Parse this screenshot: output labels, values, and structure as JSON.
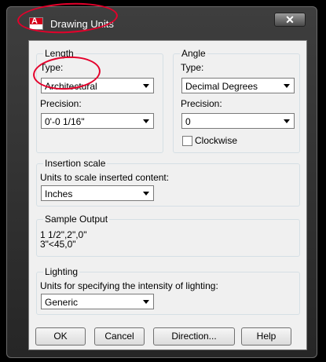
{
  "window": {
    "title": "Drawing Units",
    "app_icon_letter": "A",
    "close_label": "✕"
  },
  "length": {
    "legend": "Length",
    "type_label": "Type:",
    "type_value": "Architectural",
    "precision_label": "Precision:",
    "precision_value": "0'-0 1/16\""
  },
  "angle": {
    "legend": "Angle",
    "type_label": "Type:",
    "type_value": "Decimal Degrees",
    "precision_label": "Precision:",
    "precision_value": "0",
    "clockwise_label": "Clockwise",
    "clockwise_checked": false
  },
  "insertion": {
    "legend": "Insertion scale",
    "units_label": "Units to scale inserted content:",
    "units_value": "Inches"
  },
  "sample": {
    "legend": "Sample Output",
    "line1": "1 1/2\",2\",0\"",
    "line2": "3\"<45,0\""
  },
  "lighting": {
    "legend": "Lighting",
    "units_label": "Units for specifying the intensity of lighting:",
    "units_value": "Generic"
  },
  "buttons": {
    "ok": "OK",
    "cancel": "Cancel",
    "direction": "Direction...",
    "help": "Help"
  },
  "annotation_color": "#e4002b"
}
